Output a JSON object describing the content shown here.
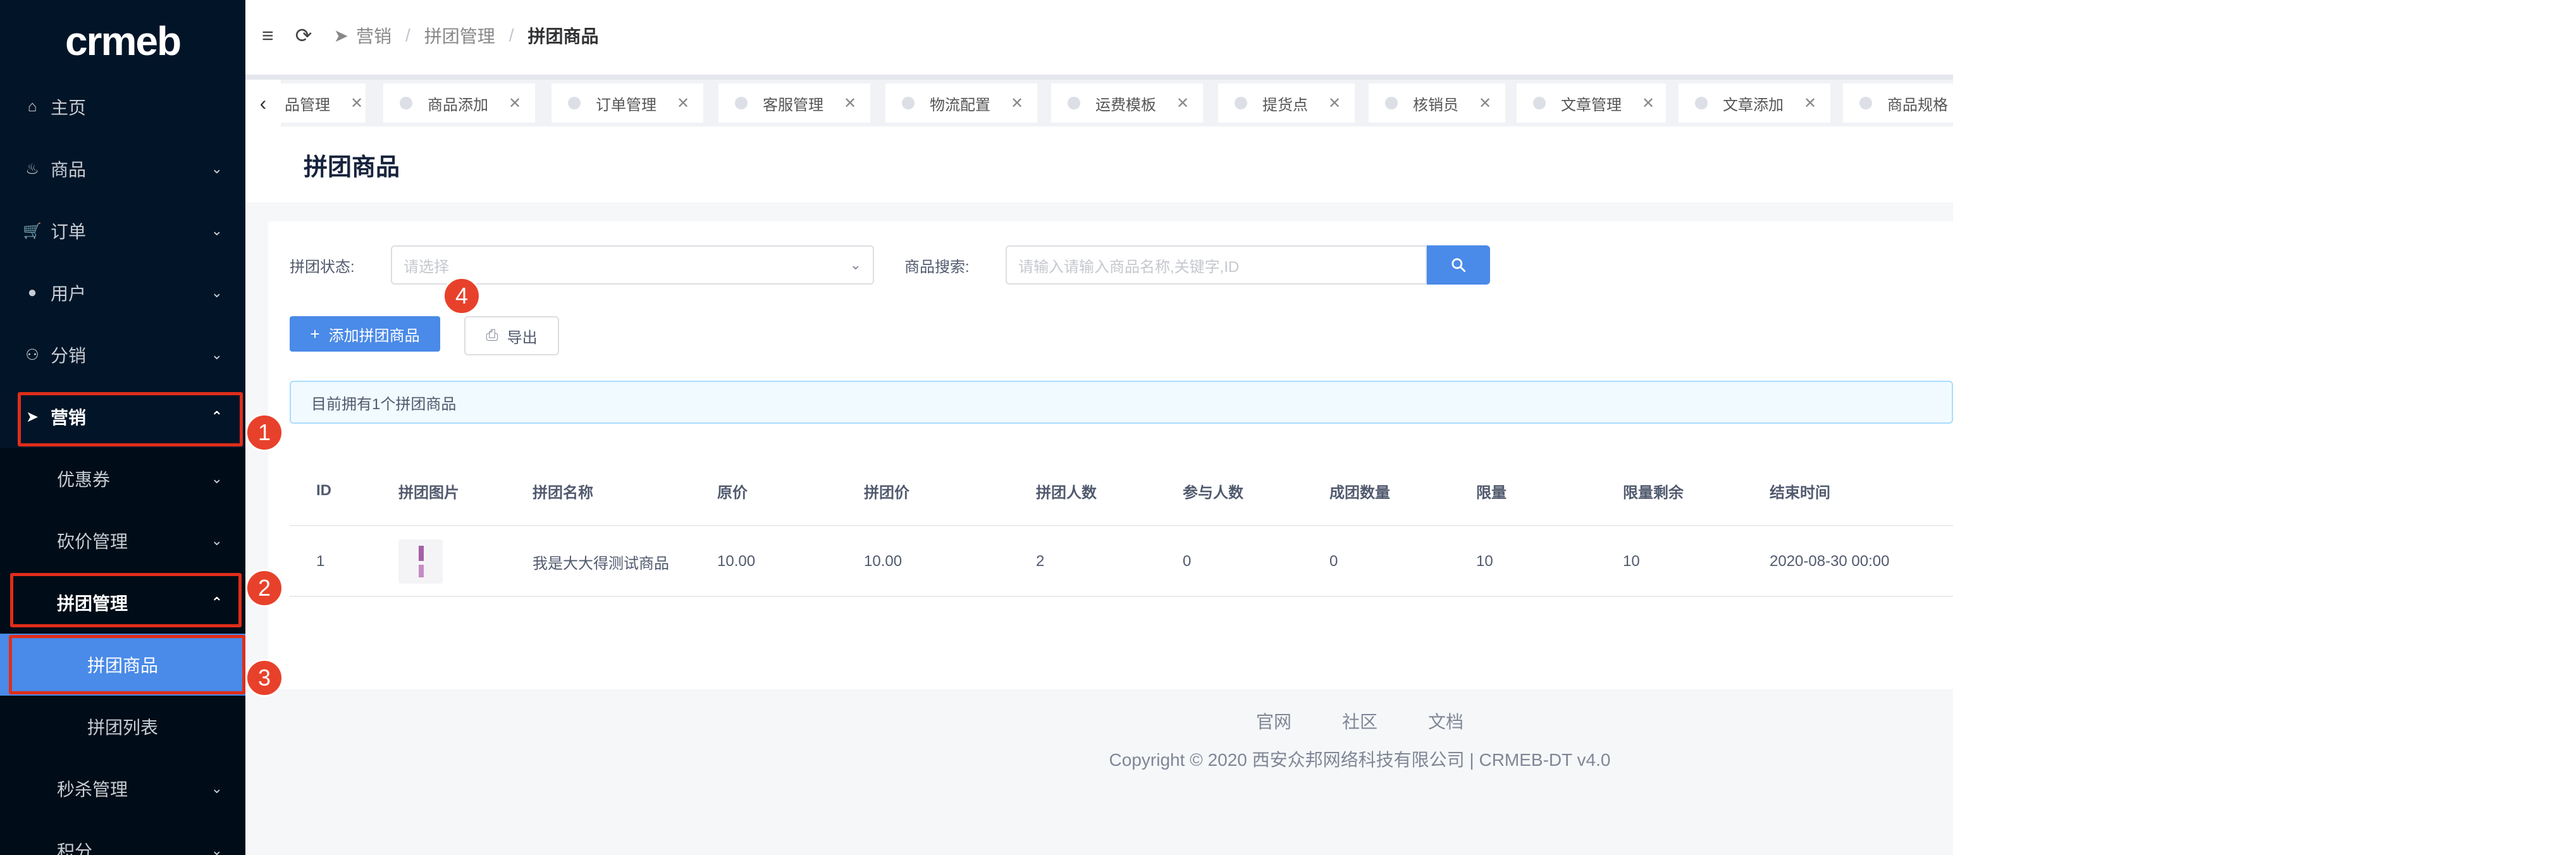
{
  "brand": {
    "logo_text": "crmeb"
  },
  "sidebar": {
    "items": [
      {
        "label": "主页",
        "icon": "home-icon"
      },
      {
        "label": "商品",
        "icon": "basket-icon"
      },
      {
        "label": "订单",
        "icon": "cart-icon"
      },
      {
        "label": "用户",
        "icon": "user-icon"
      },
      {
        "label": "分销",
        "icon": "distribution-icon"
      },
      {
        "label": "营销",
        "icon": "send-icon"
      }
    ],
    "marketing_sub": [
      {
        "label": "优惠券"
      },
      {
        "label": "砍价管理"
      },
      {
        "label": "拼团管理"
      }
    ],
    "group_sub": [
      {
        "label": "拼团商品"
      },
      {
        "label": "拼团列表"
      }
    ],
    "after": [
      {
        "label": "秒杀管理"
      },
      {
        "label": "积分"
      }
    ]
  },
  "header": {
    "breadcrumb": [
      "营销",
      "拼团管理",
      "拼团商品"
    ]
  },
  "tabs": [
    {
      "label": "品管理"
    },
    {
      "label": "商品添加"
    },
    {
      "label": "订单管理"
    },
    {
      "label": "客服管理"
    },
    {
      "label": "物流配置"
    },
    {
      "label": "运费模板"
    },
    {
      "label": "提货点"
    },
    {
      "label": "核销员"
    },
    {
      "label": "文章管理"
    },
    {
      "label": "文章添加"
    },
    {
      "label": "商品规格"
    }
  ],
  "page": {
    "title": "拼团商品"
  },
  "filters": {
    "status_label": "拼团状态:",
    "status_placeholder": "请选择",
    "search_label": "商品搜索:",
    "search_placeholder": "请输入请输入商品名称,关键字,ID"
  },
  "actions": {
    "add_label": "添加拼团商品",
    "export_label": "导出"
  },
  "alert": {
    "text": "目前拥有1个拼团商品"
  },
  "table": {
    "headers": [
      "ID",
      "拼团图片",
      "拼团名称",
      "原价",
      "拼团价",
      "拼团人数",
      "参与人数",
      "成团数量",
      "限量",
      "限量剩余",
      "结束时间"
    ],
    "rows": [
      {
        "id": "1",
        "name": "我是大大得测试商品",
        "price": "10.00",
        "group_price": "10.00",
        "group_size": "2",
        "participants": "0",
        "groups_formed": "0",
        "limit": "10",
        "limit_left": "10",
        "end_time": "2020-08-30 00:00"
      }
    ]
  },
  "footer": {
    "links": [
      "官网",
      "社区",
      "文档"
    ],
    "copyright": "Copyright © 2020 西安众邦网络科技有限公司 | CRMEB-DT v4.0"
  },
  "annotations": [
    "1",
    "2",
    "3",
    "4"
  ],
  "colors": {
    "sidebar_bg": "#021528",
    "accent": "#4a8ae8",
    "highlight": "#e02d1a"
  }
}
